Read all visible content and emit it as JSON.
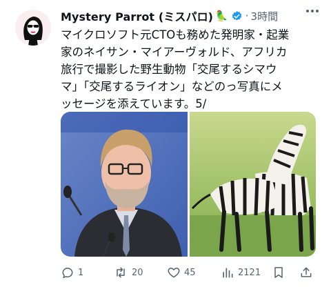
{
  "author": {
    "name": "Mystery Parrot (ミスパロ)",
    "parrot_emoji": "🦜",
    "avatar_icon": "woman-sunglasses-avatar",
    "verified": true
  },
  "meta": {
    "separator": "·",
    "time": "3時間"
  },
  "tweet": {
    "text": "マイクロソフト元CTOも務めた発明家・起業\n家のネイサン・マイアーヴォルド、アフリカ\n旅行で撮影した野生動物「交尾するシマウ\nマ」「交尾するライオン」などのっ写真にメ\nッセージを添えています。5/"
  },
  "media": [
    {
      "icon": "man-speaking-photo"
    },
    {
      "icon": "zebras-photo"
    }
  ],
  "actions": {
    "replies": "1",
    "retweets": "20",
    "likes": "45",
    "views": "2121"
  },
  "colors": {
    "text": "#0f1419",
    "secondary": "#536471",
    "verified": "#1d9bf0"
  }
}
